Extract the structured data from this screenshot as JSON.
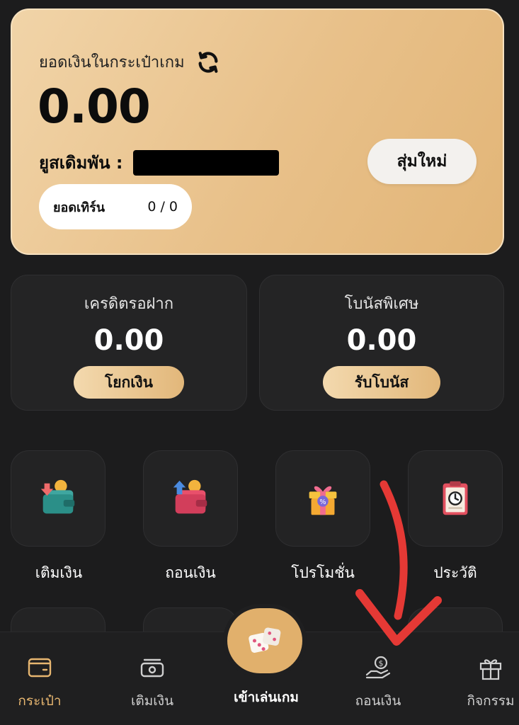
{
  "wallet": {
    "title": "ยอดเงินในกระเป๋าเกม",
    "balance": "0.00",
    "user_label": "ยูสเดิมพัน :",
    "random_button": "สุ่มใหม่",
    "turnover_label": "ยอดเทิร์น",
    "turnover_value": "0 / 0"
  },
  "cards": [
    {
      "label": "เครดิตรอฝาก",
      "amount": "0.00",
      "button": "โยกเงิน"
    },
    {
      "label": "โบนัสพิเศษ",
      "amount": "0.00",
      "button": "รับโบนัส"
    }
  ],
  "menu": [
    {
      "label": "เติมเงิน",
      "icon": "wallet-deposit-icon"
    },
    {
      "label": "ถอนเงิน",
      "icon": "wallet-withdraw-icon"
    },
    {
      "label": "โปรโมชั่น",
      "icon": "gift-promo-icon"
    },
    {
      "label": "ประวัติ",
      "icon": "clipboard-clock-icon"
    }
  ],
  "nav": [
    {
      "label": "กระเป๋า",
      "icon": "wallet-icon",
      "active": true
    },
    {
      "label": "เติมเงิน",
      "icon": "cash-icon"
    },
    {
      "label": "เข้าเล่นเกม",
      "icon": "dice-icon"
    },
    {
      "label": "ถอนเงิน",
      "icon": "hand-coin-icon"
    },
    {
      "label": "กิจกรรม",
      "icon": "gift-icon"
    }
  ],
  "colors": {
    "accent": "#e1b06c",
    "annotation": "#e53935",
    "background": "#1c1c1d"
  }
}
